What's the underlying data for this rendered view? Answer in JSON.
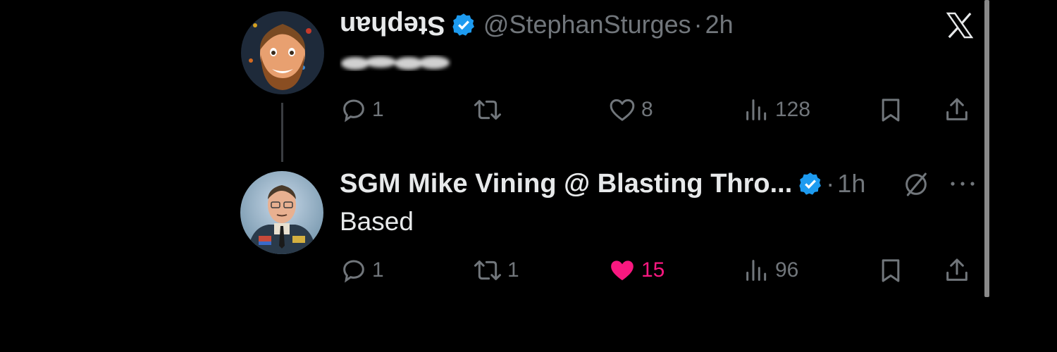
{
  "colors": {
    "background": "#000000",
    "text_primary": "#e7e9ea",
    "text_secondary": "#71767b",
    "verified_blue": "#1d9bf0",
    "like_pink": "#f91880"
  },
  "app": {
    "logo_icon": "x-logo-icon"
  },
  "tweets": [
    {
      "name": "Stephan",
      "name_display": "upside-down",
      "verified": true,
      "handle": "@StephanSturges",
      "separator": "·",
      "time": "2h",
      "text_redacted": true,
      "actions": {
        "replies": "1",
        "retweets": "",
        "likes": "8",
        "views": "128",
        "liked": false
      }
    },
    {
      "name": "SGM Mike Vining @ Blasting Thro...",
      "verified": true,
      "separator": "·",
      "time": "1h",
      "text": "Based",
      "actions": {
        "replies": "1",
        "retweets": "1",
        "likes": "15",
        "views": "96",
        "liked": true
      }
    }
  ]
}
